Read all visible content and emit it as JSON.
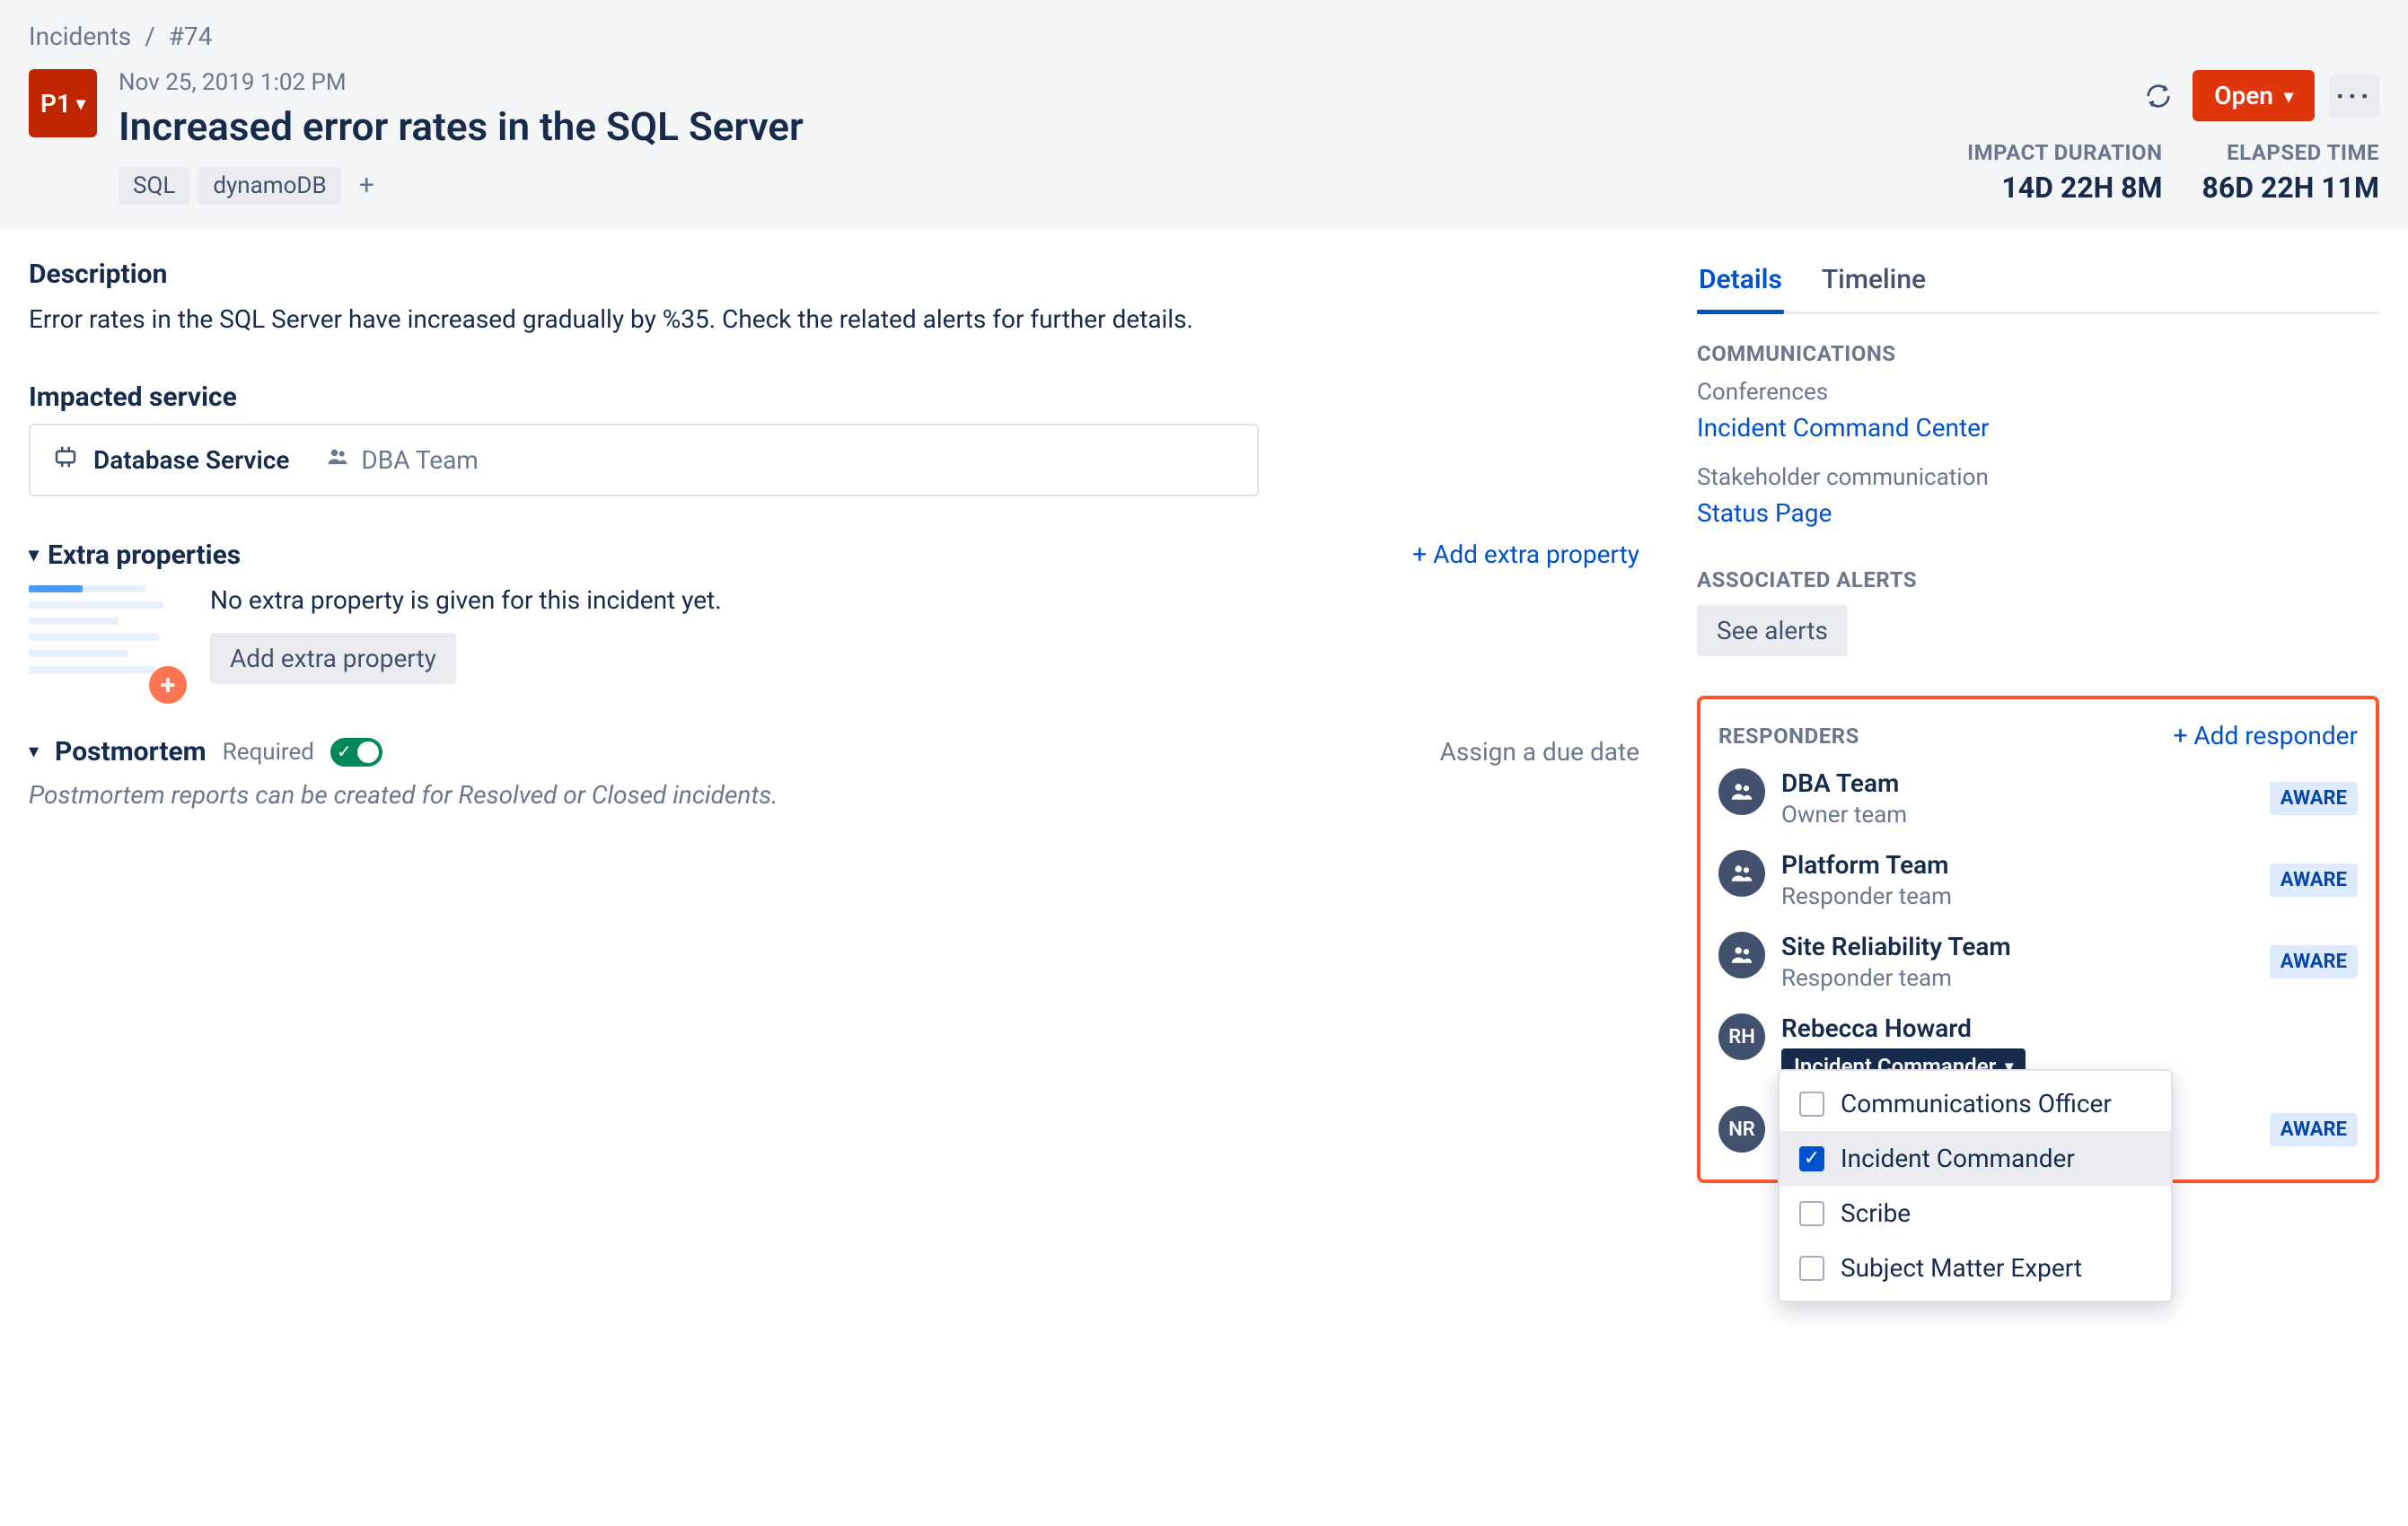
{
  "breadcrumb": {
    "root": "Incidents",
    "id": "#74"
  },
  "priority": "P1",
  "timestamp": "Nov 25, 2019 1:02 PM",
  "title": "Increased error rates in the SQL Server",
  "tags": [
    "SQL",
    "dynamoDB"
  ],
  "status_button": "Open",
  "durations": {
    "impact_label": "IMPACT DURATION",
    "impact_value": "14D 22H 8M",
    "elapsed_label": "ELAPSED TIME",
    "elapsed_value": "86D 22H 11M"
  },
  "description": {
    "heading": "Description",
    "text": "Error rates in the SQL Server have increased gradually by %35. Check the related alerts for further details."
  },
  "impacted_service": {
    "heading": "Impacted service",
    "service": "Database Service",
    "team": "DBA Team"
  },
  "extra_properties": {
    "heading": "Extra properties",
    "add_link": "+ Add extra property",
    "empty_msg": "No extra property is given for this incident yet.",
    "add_button": "Add extra property"
  },
  "postmortem": {
    "heading": "Postmortem",
    "required_label": "Required",
    "assign_link": "Assign a due date",
    "note": "Postmortem reports can be created for Resolved or Closed incidents."
  },
  "tabs": {
    "details": "Details",
    "timeline": "Timeline"
  },
  "communications": {
    "heading": "COMMUNICATIONS",
    "conferences_label": "Conferences",
    "conference_link": "Incident Command Center",
    "stakeholder_label": "Stakeholder communication",
    "stakeholder_link": "Status Page"
  },
  "associated_alerts": {
    "heading": "ASSOCIATED ALERTS",
    "button": "See alerts"
  },
  "responders": {
    "heading": "RESPONDERS",
    "add_link": "+ Add responder",
    "aware_label": "AWARE",
    "items": [
      {
        "name": "DBA Team",
        "role": "Owner team",
        "initials": "",
        "type": "team",
        "aware": true
      },
      {
        "name": "Platform Team",
        "role": "Responder team",
        "initials": "",
        "type": "team",
        "aware": true
      },
      {
        "name": "Site Reliability Team",
        "role": "Responder team",
        "initials": "",
        "type": "team",
        "aware": true
      },
      {
        "name": "Rebecca Howard",
        "role_pill": "Incident Commander",
        "initials": "RH",
        "type": "user",
        "aware": false
      },
      {
        "name": "",
        "role": "",
        "initials": "NR",
        "type": "user",
        "aware": true
      }
    ],
    "role_options": [
      {
        "label": "Communications Officer",
        "checked": false
      },
      {
        "label": "Incident Commander",
        "checked": true
      },
      {
        "label": "Scribe",
        "checked": false
      },
      {
        "label": "Subject Matter Expert",
        "checked": false
      }
    ]
  }
}
